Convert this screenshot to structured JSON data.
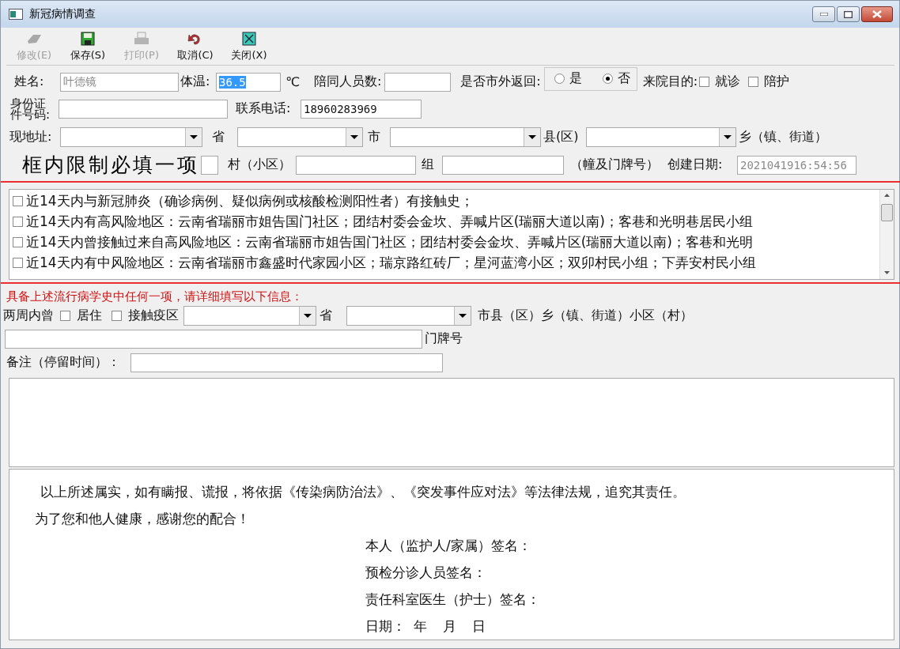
{
  "window": {
    "title": "新冠病情调查"
  },
  "toolbar": [
    {
      "label": "修改(E)",
      "kind": "edit",
      "disabled": true
    },
    {
      "label": "保存(S)",
      "kind": "save",
      "disabled": false
    },
    {
      "label": "打印(P)",
      "kind": "print",
      "disabled": true
    },
    {
      "label": "取消(C)",
      "kind": "undo",
      "disabled": false
    },
    {
      "label": "关闭(X)",
      "kind": "close",
      "disabled": false
    }
  ],
  "form": {
    "name": {
      "label": "姓名:",
      "value": "叶德镜",
      "disabled": true
    },
    "temperature": {
      "label": "体温:",
      "value": "36.5",
      "text_selected": true,
      "unit": "℃"
    },
    "companions": {
      "label": "陪同人员数:"
    },
    "returned": {
      "label": "是否市外返回:",
      "options": [
        {
          "label": "是",
          "selected": false
        },
        {
          "label": "否",
          "selected": true
        }
      ]
    },
    "purpose": {
      "label": "来院目的:",
      "options": [
        {
          "label": "就诊",
          "checked": false
        },
        {
          "label": "陪护",
          "checked": false
        }
      ]
    },
    "id_number": {
      "label": "身份证件号码:"
    },
    "phone": {
      "label": "联系电话:",
      "value": "18960283969"
    },
    "address": {
      "label": "现地址:",
      "parts": [
        "省",
        "市",
        "县(区)",
        "乡（镇、街道）"
      ]
    },
    "required_note": "框内限制必填一项",
    "village": {
      "label": "村（小区）"
    },
    "group": {
      "label": "组"
    },
    "building_note": "（幢及门牌号）",
    "created": {
      "label": "创建日期:",
      "value": "2021041916:54:56",
      "disabled": true
    }
  },
  "history_list": [
    {
      "text": "近14天内与新冠肺炎（确诊病例、疑似病例或核酸检测阳性者）有接触史；",
      "checked": false
    },
    {
      "text": "近14天内有高风险地区：云南省瑞丽市姐告国门社区；团结村委会金坎、弄喊片区(瑞丽大道以南)；客巷和光明巷居民小组",
      "checked": false
    },
    {
      "text": "近14天内曾接触过来自高风险地区：云南省瑞丽市姐告国门社区；团结村委会金坎、弄喊片区(瑞丽大道以南)；客巷和光明",
      "checked": false
    },
    {
      "text": "近14天内有中风险地区：云南省瑞丽市鑫盛时代家园小区；瑞京路红砖厂；星河蓝湾小区；双卯村民小组；下弄安村民小组",
      "checked": false
    }
  ],
  "details": {
    "warning": "具备上述流行病学史中任何一项，请详细填写以下信息：",
    "prefix": "两周内曾",
    "options": [
      {
        "label": "居住",
        "checked": false
      },
      {
        "label": "接触疫区",
        "checked": false
      }
    ],
    "province": "省",
    "rest": "市县（区）乡（镇、街道）小区（村）",
    "house_number": "门牌号",
    "remark": "备注（停留时间）："
  },
  "statement": {
    "paragraphs": [
      "以上所述属实，如有瞒报、谎报，将依据《传染病防治法》、《突发事件应对法》等法律法规，追究其责任。",
      "为了您和他人健康，感谢您的配合！"
    ],
    "signatures": [
      "本人（监护人/家属）签名：",
      "预检分诊人员签名：",
      "责任科室医生（护士）签名："
    ],
    "date": {
      "label": "日期：",
      "parts": [
        "年",
        "月",
        "日"
      ]
    }
  }
}
